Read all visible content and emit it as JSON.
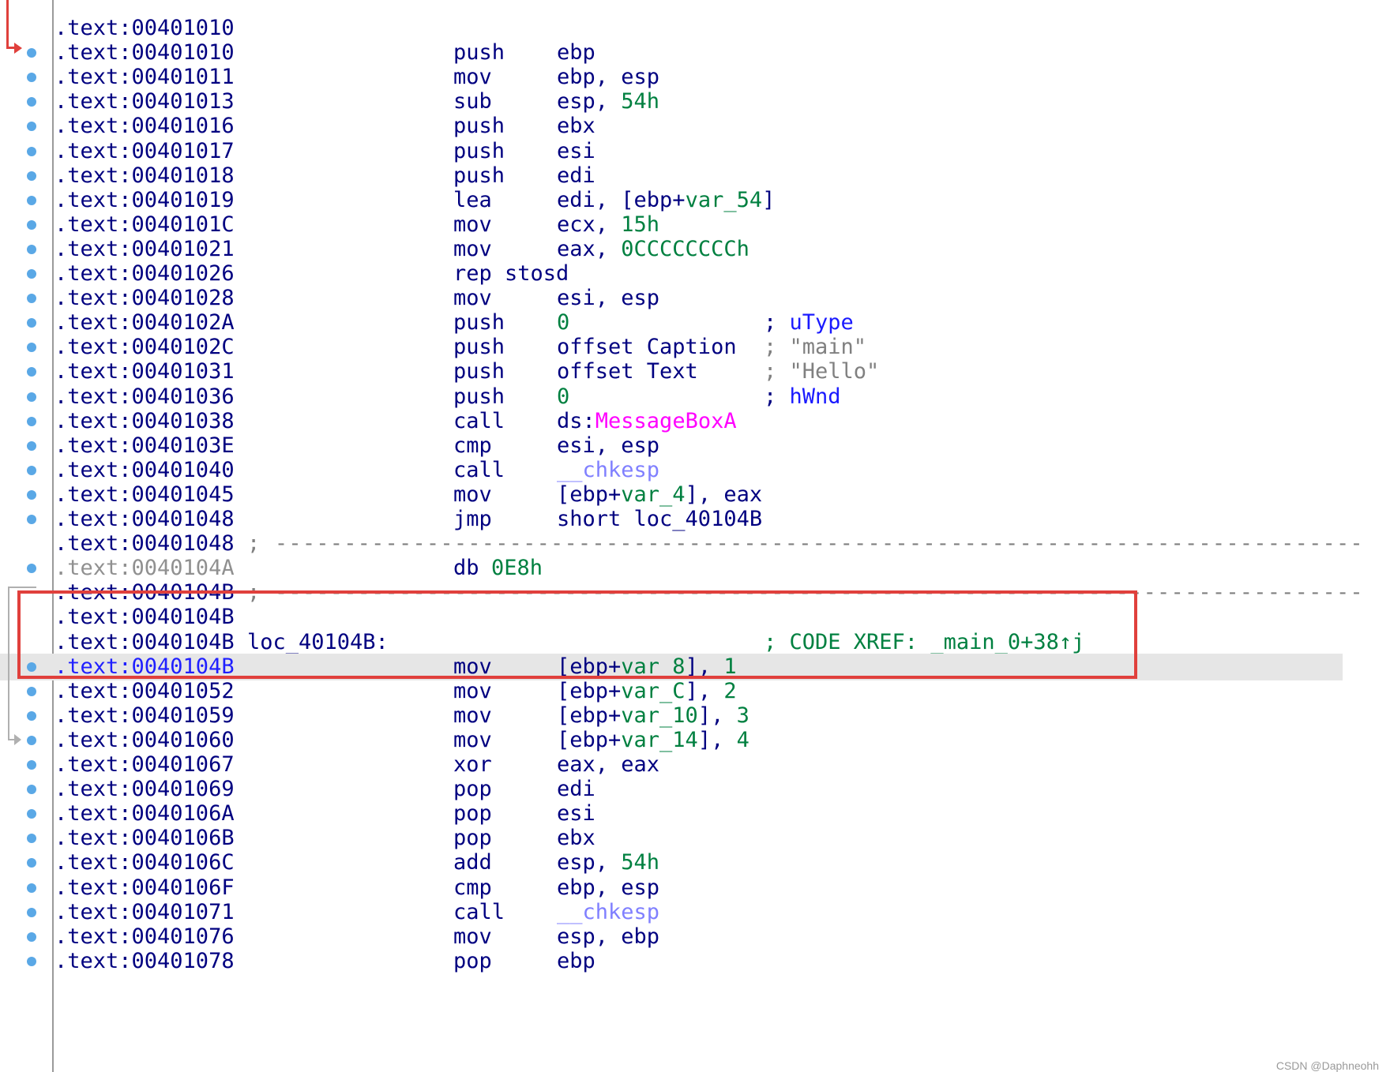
{
  "colors": {
    "address": "#000080",
    "current_address": "#2020ff",
    "data_address": "#909090",
    "number": "#008040",
    "import_name": "#ff00ff",
    "library_function": "#8080ff",
    "comment": "#1a1aff",
    "highlight_box": "#e0403c",
    "breakpoint_dot": "#5aa8e6"
  },
  "icons": {
    "flow_arrow": "entry-arrow-icon",
    "jump_arrow": "jump-arrow-icon",
    "breakpoint": "breakpoint-dot-icon"
  },
  "lines": [
    {
      "addr": ".text:00401010",
      "dot": false
    },
    {
      "addr": ".text:00401010",
      "mn": "push",
      "op": [
        {
          "t": "ebp"
        }
      ],
      "dot": true
    },
    {
      "addr": ".text:00401011",
      "mn": "mov",
      "op": [
        {
          "t": "ebp, esp"
        }
      ],
      "dot": true
    },
    {
      "addr": ".text:00401013",
      "mn": "sub",
      "op": [
        {
          "t": "esp, "
        },
        {
          "t": "54h",
          "c": "num"
        }
      ],
      "dot": true
    },
    {
      "addr": ".text:00401016",
      "mn": "push",
      "op": [
        {
          "t": "ebx"
        }
      ],
      "dot": true
    },
    {
      "addr": ".text:00401017",
      "mn": "push",
      "op": [
        {
          "t": "esi"
        }
      ],
      "dot": true
    },
    {
      "addr": ".text:00401018",
      "mn": "push",
      "op": [
        {
          "t": "edi"
        }
      ],
      "dot": true
    },
    {
      "addr": ".text:00401019",
      "mn": "lea",
      "op": [
        {
          "t": "edi, [ebp+"
        },
        {
          "t": "var_54",
          "c": "num"
        },
        {
          "t": "]"
        }
      ],
      "dot": true
    },
    {
      "addr": ".text:0040101C",
      "mn": "mov",
      "op": [
        {
          "t": "ecx, "
        },
        {
          "t": "15h",
          "c": "num"
        }
      ],
      "dot": true
    },
    {
      "addr": ".text:00401021",
      "mn": "mov",
      "op": [
        {
          "t": "eax, "
        },
        {
          "t": "0CCCCCCCCh",
          "c": "num"
        }
      ],
      "dot": true
    },
    {
      "addr": ".text:00401026",
      "mn": "rep stosd",
      "dot": true
    },
    {
      "addr": ".text:00401028",
      "mn": "mov",
      "op": [
        {
          "t": "esi, esp"
        }
      ],
      "dot": true
    },
    {
      "addr": ".text:0040102A",
      "mn": "push",
      "op": [
        {
          "t": "0",
          "c": "num"
        }
      ],
      "cm": [
        {
          "t": "; ",
          "c": "semi"
        },
        {
          "t": "uType",
          "c": "cmt"
        }
      ],
      "dot": true
    },
    {
      "addr": ".text:0040102C",
      "mn": "push",
      "op": [
        {
          "t": "offset Caption"
        }
      ],
      "cm": [
        {
          "t": "; ",
          "c": "str"
        },
        {
          "t": "\"main\"",
          "c": "str"
        }
      ],
      "dot": true
    },
    {
      "addr": ".text:00401031",
      "mn": "push",
      "op": [
        {
          "t": "offset Text"
        }
      ],
      "cm": [
        {
          "t": "; ",
          "c": "str"
        },
        {
          "t": "\"Hello\"",
          "c": "str"
        }
      ],
      "dot": true
    },
    {
      "addr": ".text:00401036",
      "mn": "push",
      "op": [
        {
          "t": "0",
          "c": "num"
        }
      ],
      "cm": [
        {
          "t": "; ",
          "c": "semi"
        },
        {
          "t": "hWnd",
          "c": "cmt"
        }
      ],
      "dot": true
    },
    {
      "addr": ".text:00401038",
      "mn": "call",
      "op": [
        {
          "t": "ds:"
        },
        {
          "t": "MessageBoxA",
          "c": "imp"
        }
      ],
      "dot": true
    },
    {
      "addr": ".text:0040103E",
      "mn": "cmp",
      "op": [
        {
          "t": "esi, esp"
        }
      ],
      "dot": true
    },
    {
      "addr": ".text:00401040",
      "mn": "call",
      "op": [
        {
          "t": "__chkesp",
          "c": "sub"
        }
      ],
      "dot": true
    },
    {
      "addr": ".text:00401045",
      "mn": "mov",
      "op": [
        {
          "t": "[ebp+"
        },
        {
          "t": "var_4",
          "c": "num"
        },
        {
          "t": "], eax"
        }
      ],
      "dot": true
    },
    {
      "addr": ".text:00401048",
      "mn": "jmp",
      "op": [
        {
          "t": "short loc_40104B"
        }
      ],
      "dot": true
    },
    {
      "addr": ".text:00401048",
      "sep": "; -------------------------------------------------------------------------------",
      "dot": false
    },
    {
      "addr": ".text:0040104A",
      "addr_style": "grey",
      "mn": "db",
      "op": [
        {
          "t": "0E8h",
          "c": "num"
        }
      ],
      "dot": true,
      "op_left": "mn2"
    },
    {
      "addr": ".text:0040104B",
      "sep": "; -------------------------------------------------------------------------------",
      "dot": false
    },
    {
      "addr": ".text:0040104B",
      "dot": false
    },
    {
      "addr": ".text:0040104B",
      "label": "loc_40104B:",
      "cm": [
        {
          "t": "; CODE XREF: _main_0+38↑j",
          "c": "xref"
        }
      ],
      "dot": false
    },
    {
      "addr": ".text:0040104B",
      "addr_style": "blue",
      "highlight": true,
      "mn": "mov",
      "op": [
        {
          "t": "[ebp+"
        },
        {
          "t": "var_8",
          "c": "num"
        },
        {
          "t": "], "
        },
        {
          "t": "1",
          "c": "num"
        }
      ],
      "dot": true
    },
    {
      "addr": ".text:00401052",
      "mn": "mov",
      "op": [
        {
          "t": "[ebp+"
        },
        {
          "t": "var_C",
          "c": "num"
        },
        {
          "t": "], "
        },
        {
          "t": "2",
          "c": "num"
        }
      ],
      "dot": true
    },
    {
      "addr": ".text:00401059",
      "mn": "mov",
      "op": [
        {
          "t": "[ebp+"
        },
        {
          "t": "var_10",
          "c": "num"
        },
        {
          "t": "], "
        },
        {
          "t": "3",
          "c": "num"
        }
      ],
      "dot": true
    },
    {
      "addr": ".text:00401060",
      "mn": "mov",
      "op": [
        {
          "t": "[ebp+"
        },
        {
          "t": "var_14",
          "c": "num"
        },
        {
          "t": "], "
        },
        {
          "t": "4",
          "c": "num"
        }
      ],
      "dot": true
    },
    {
      "addr": ".text:00401067",
      "mn": "xor",
      "op": [
        {
          "t": "eax, eax"
        }
      ],
      "dot": true
    },
    {
      "addr": ".text:00401069",
      "mn": "pop",
      "op": [
        {
          "t": "edi"
        }
      ],
      "dot": true
    },
    {
      "addr": ".text:0040106A",
      "mn": "pop",
      "op": [
        {
          "t": "esi"
        }
      ],
      "dot": true
    },
    {
      "addr": ".text:0040106B",
      "mn": "pop",
      "op": [
        {
          "t": "ebx"
        }
      ],
      "dot": true
    },
    {
      "addr": ".text:0040106C",
      "mn": "add",
      "op": [
        {
          "t": "esp, "
        },
        {
          "t": "54h",
          "c": "num"
        }
      ],
      "dot": true
    },
    {
      "addr": ".text:0040106F",
      "mn": "cmp",
      "op": [
        {
          "t": "ebp, esp"
        }
      ],
      "dot": true
    },
    {
      "addr": ".text:00401071",
      "mn": "call",
      "op": [
        {
          "t": "__chkesp",
          "c": "sub"
        }
      ],
      "dot": true
    },
    {
      "addr": ".text:00401076",
      "mn": "mov",
      "op": [
        {
          "t": "esp, ebp"
        }
      ],
      "dot": true
    },
    {
      "addr": ".text:00401078",
      "mn": "pop",
      "op": [
        {
          "t": "ebp"
        }
      ],
      "dot": true
    }
  ],
  "watermark": "CSDN @Daphneohh"
}
